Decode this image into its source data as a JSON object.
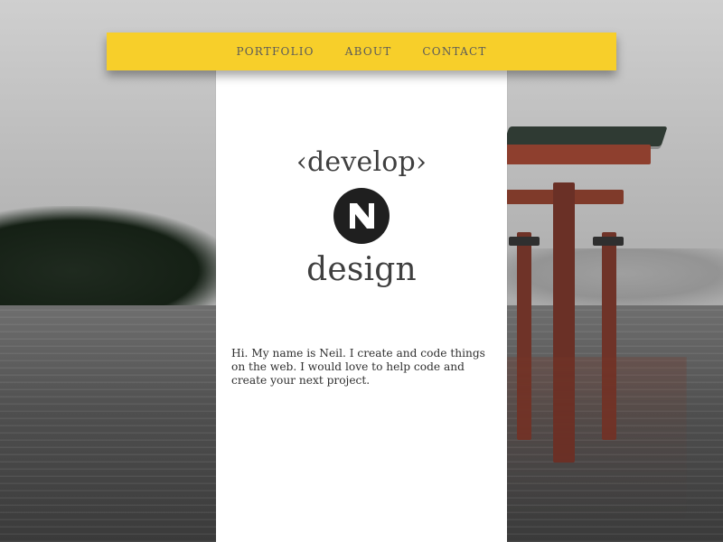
{
  "nav": {
    "items": [
      {
        "label": "PORTFOLIO"
      },
      {
        "label": "ABOUT"
      },
      {
        "label": "CONTACT"
      }
    ]
  },
  "logo": {
    "top_text": "‹develop›",
    "bottom_text": "design",
    "mark_icon": "n-logo-icon"
  },
  "intro": {
    "text": "Hi. My name is Neil. I create and code things on the web. I would love to help code and create your next project."
  },
  "colors": {
    "nav_background": "#f7cf2a",
    "card_background": "#ffffff",
    "text_primary": "#3f3f3f",
    "text_secondary": "#5a5a5a"
  }
}
